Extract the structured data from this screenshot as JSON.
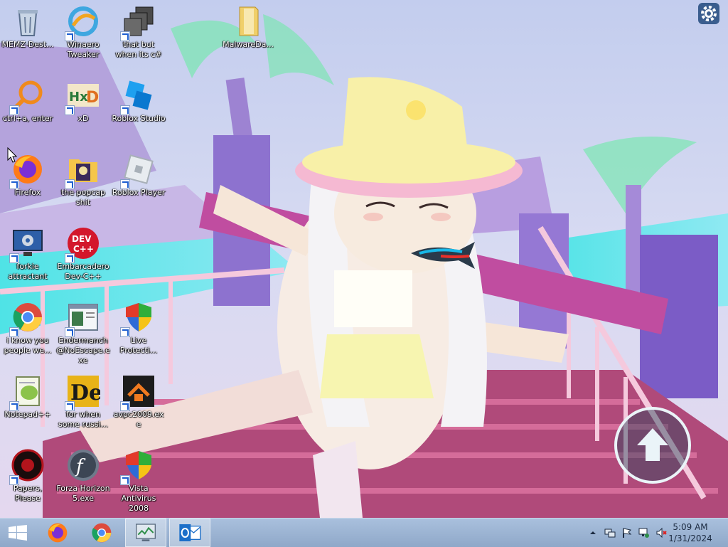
{
  "desktop": {
    "icons": [
      {
        "label": "MEMZ-Dest...",
        "icon": "recycle-bin-icon"
      },
      {
        "label": "Winaero Tweaker",
        "icon": "winaero-icon"
      },
      {
        "label": "that but when its c#",
        "icon": "stack-icon"
      },
      {
        "label": "MalwareDa...",
        "icon": "folder-icon"
      },
      {
        "label": "ctrl+a, enter",
        "icon": "magnifier-icon"
      },
      {
        "label": "xD",
        "icon": "hxd-icon"
      },
      {
        "label": "Roblox Studio",
        "icon": "roblox-studio-icon"
      },
      {
        "label": "Firefox",
        "icon": "firefox-icon"
      },
      {
        "label": "the popcap shit",
        "icon": "popcap-folder-icon"
      },
      {
        "label": "Roblox Player",
        "icon": "roblox-player-icon"
      },
      {
        "label": "forkie attractant",
        "icon": "computer-gear-icon"
      },
      {
        "label": "Embarcadero Dev-C++",
        "icon": "devcpp-icon"
      },
      {
        "label": "i know you people we...",
        "icon": "chrome-icon"
      },
      {
        "label": "Endermanch @NoEscape.exe",
        "icon": "window-icon"
      },
      {
        "label": "Live Protecti...",
        "icon": "shield-icon"
      },
      {
        "label": "Notepad++",
        "icon": "notepadpp-icon"
      },
      {
        "label": "for when some russi...",
        "icon": "de-icon"
      },
      {
        "label": "avpc2009.exe",
        "icon": "avpc-icon"
      },
      {
        "label": "Papers, Please",
        "icon": "papers-please-icon"
      },
      {
        "label": "Forza Horizon 5.exe",
        "icon": "flash-icon"
      },
      {
        "label": "Vista Antivirus 2008",
        "icon": "shield-icon"
      }
    ]
  },
  "taskbar": {
    "pinned": [
      {
        "name": "firefox",
        "icon": "firefox-icon"
      },
      {
        "name": "chrome",
        "icon": "chrome-icon"
      },
      {
        "name": "task-manager",
        "icon": "monitor-icon"
      },
      {
        "name": "outlook",
        "icon": "outlook-icon"
      }
    ],
    "tray": [
      "chevron-up-icon",
      "network-icon",
      "flag-icon",
      "action-center-icon",
      "volume-muted-icon"
    ],
    "clock": {
      "time": "5:09 AM",
      "date": "1/31/2024"
    }
  },
  "colors": {
    "taskbar": "#9bb3d3",
    "label_text": "#ffffff",
    "accent": "#1e5fd0"
  }
}
